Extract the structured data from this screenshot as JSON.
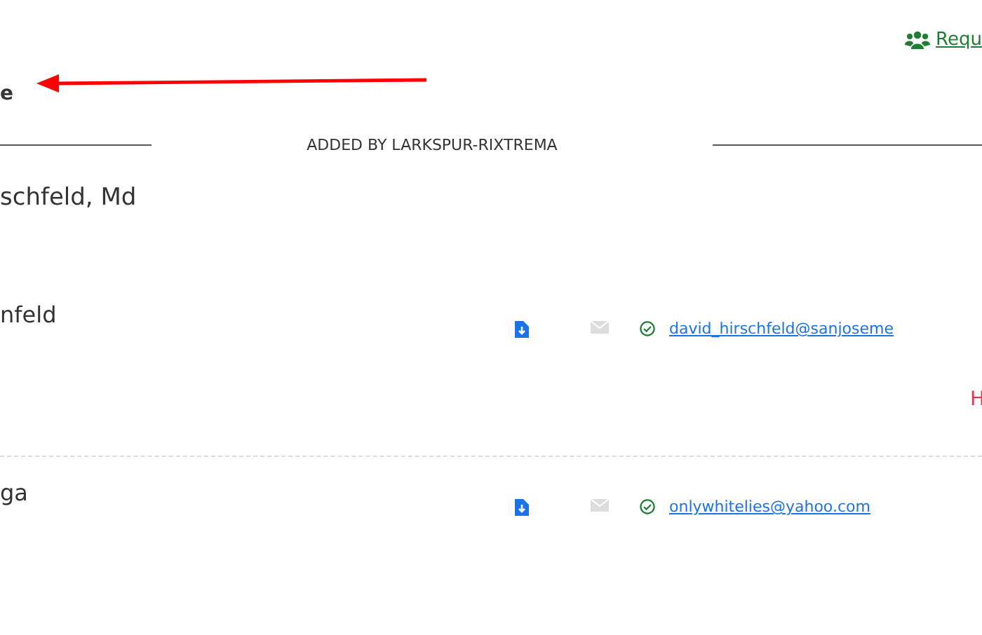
{
  "top_link": {
    "label": "Requ"
  },
  "heading": "e",
  "section": {
    "label": "ADDED BY LARKSPUR-RIXTREMA"
  },
  "group_title": "schfeld, Md",
  "contacts": [
    {
      "name": "nfeld",
      "email": "david_hirschfeld@sanjoseme",
      "verified": true,
      "note": "H"
    },
    {
      "name": "ga",
      "email": "onlywhitelies@yahoo.com",
      "verified": true
    }
  ]
}
